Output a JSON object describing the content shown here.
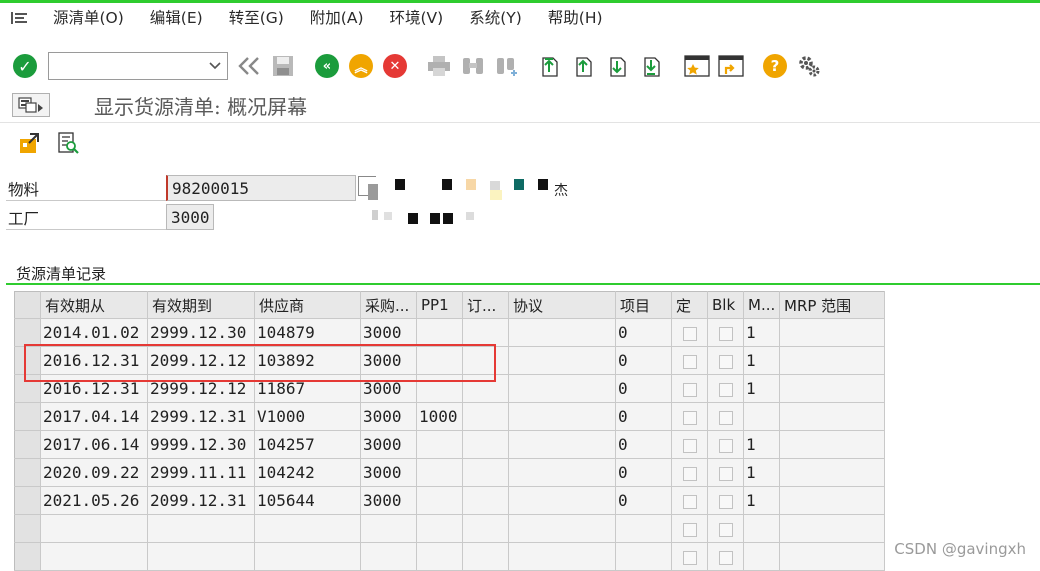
{
  "menu": {
    "items": [
      {
        "label": "源清单(O)"
      },
      {
        "label": "编辑(E)"
      },
      {
        "label": "转至(G)"
      },
      {
        "label": "附加(A)"
      },
      {
        "label": "环境(V)"
      },
      {
        "label": "系统(Y)"
      },
      {
        "label": "帮助(H)"
      }
    ]
  },
  "toolbar": {
    "command_value": "",
    "icons": [
      "enter-icon",
      "save-icon",
      "back-icon",
      "exit-icon",
      "cancel-icon",
      "print-icon",
      "find-icon",
      "find-next-icon",
      "first-page-icon",
      "previous-page-icon",
      "next-page-icon",
      "last-page-icon",
      "create-session-icon",
      "shortcut-icon",
      "help-icon",
      "customize-layout-icon"
    ],
    "help_glyph": "?"
  },
  "page": {
    "title": "显示货源清单: 概况屏幕"
  },
  "header_fields": {
    "material_label": "物料",
    "material_value": "98200015",
    "material_desc_suffix": "杰",
    "plant_label": "工厂",
    "plant_value": "3000"
  },
  "section": {
    "title": "货源清单记录"
  },
  "table": {
    "columns": [
      "有效期从",
      "有效期到",
      "供应商",
      "采购...",
      "PP1",
      "订...",
      "协议",
      "项目",
      "定",
      "Blk",
      "M...",
      "MRP 范围"
    ],
    "rows": [
      {
        "valid_from": "2014.01.02",
        "valid_to": "2999.12.30",
        "vendor": "104879",
        "purch_org": "3000",
        "pp1": "",
        "order_unit": "",
        "agreement": "",
        "item": "0",
        "fixed": false,
        "blocked": false,
        "mrp": "1",
        "mrp_area": ""
      },
      {
        "valid_from": "2016.12.31",
        "valid_to": "2099.12.12",
        "vendor": "103892",
        "purch_org": "3000",
        "pp1": "",
        "order_unit": "",
        "agreement": "",
        "item": "0",
        "fixed": false,
        "blocked": false,
        "mrp": "1",
        "mrp_area": ""
      },
      {
        "valid_from": "2016.12.31",
        "valid_to": "2999.12.12",
        "vendor": "11867",
        "purch_org": "3000",
        "pp1": "",
        "order_unit": "",
        "agreement": "",
        "item": "0",
        "fixed": false,
        "blocked": false,
        "mrp": "1",
        "mrp_area": ""
      },
      {
        "valid_from": "2017.04.14",
        "valid_to": "2999.12.31",
        "vendor": "V1000",
        "purch_org": "3000",
        "pp1": "1000",
        "order_unit": "",
        "agreement": "",
        "item": "0",
        "fixed": false,
        "blocked": false,
        "mrp": "",
        "mrp_area": ""
      },
      {
        "valid_from": "2017.06.14",
        "valid_to": "9999.12.30",
        "vendor": "104257",
        "purch_org": "3000",
        "pp1": "",
        "order_unit": "",
        "agreement": "",
        "item": "0",
        "fixed": false,
        "blocked": false,
        "mrp": "1",
        "mrp_area": ""
      },
      {
        "valid_from": "2020.09.22",
        "valid_to": "2999.11.11",
        "vendor": "104242",
        "purch_org": "3000",
        "pp1": "",
        "order_unit": "",
        "agreement": "",
        "item": "0",
        "fixed": false,
        "blocked": false,
        "mrp": "1",
        "mrp_area": ""
      },
      {
        "valid_from": "2021.05.26",
        "valid_to": "2099.12.31",
        "vendor": "105644",
        "purch_org": "3000",
        "pp1": "",
        "order_unit": "",
        "agreement": "",
        "item": "0",
        "fixed": false,
        "blocked": false,
        "mrp": "1",
        "mrp_area": ""
      }
    ],
    "empty_rows": 2
  },
  "colors": {
    "accent_green": "#2fcc2f",
    "ok_green": "#1b9c3c",
    "nav_green": "#1b9c3c",
    "nav_orange": "#f0a500",
    "cancel_red": "#e53935",
    "highlight_red": "#e53935"
  },
  "watermark": "CSDN @gavingxh"
}
